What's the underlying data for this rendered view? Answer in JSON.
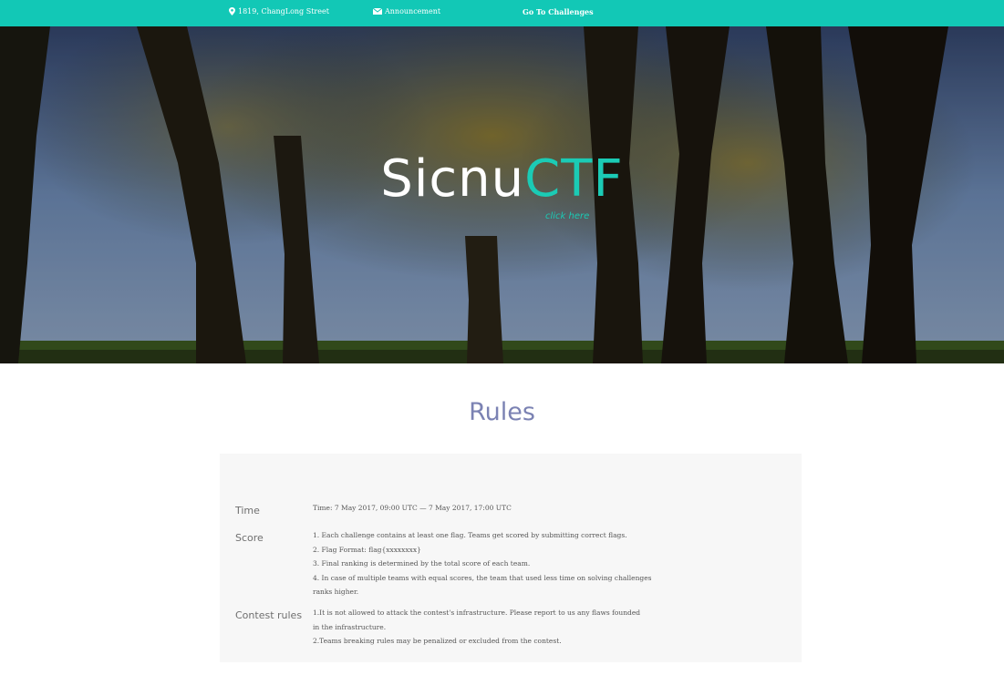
{
  "topbar": {
    "address": "1819, ChangLong Street",
    "announcement": "Announcement",
    "challenges": "Go To Challenges"
  },
  "icons": {
    "address": "map-pin-icon",
    "announcement": "envelope-icon"
  },
  "hero": {
    "logo_white": "Sicnu",
    "logo_teal": "CTF",
    "sublink": "click here"
  },
  "rules": {
    "title": "Rules",
    "time_label": "Time",
    "time_text": "Time: 7 May 2017, 09:00 UTC — 7 May 2017, 17:00 UTC",
    "score_label": "Score",
    "score_lines": [
      "1. Each challenge contains at least one flag. Teams get scored by submitting correct flags.",
      "2. Flag Format: flag{xxxxxxxx}",
      "3. Final ranking is determined by the total score of each team.",
      "4. In case of multiple teams with equal scores, the team that used less time on solving challenges",
      "ranks higher."
    ],
    "contest_label": "Contest rules",
    "contest_lines": [
      "1.It is not allowed to attack the contest's infrastructure. Please report to us any flaws founded",
      "in the infrastructure.",
      "2.Teams breaking rules may be penalized or excluded from the contest."
    ]
  },
  "colors": {
    "accent": "#12c8b6",
    "title": "#7b82b3",
    "panel_bg": "#f7f7f7"
  }
}
